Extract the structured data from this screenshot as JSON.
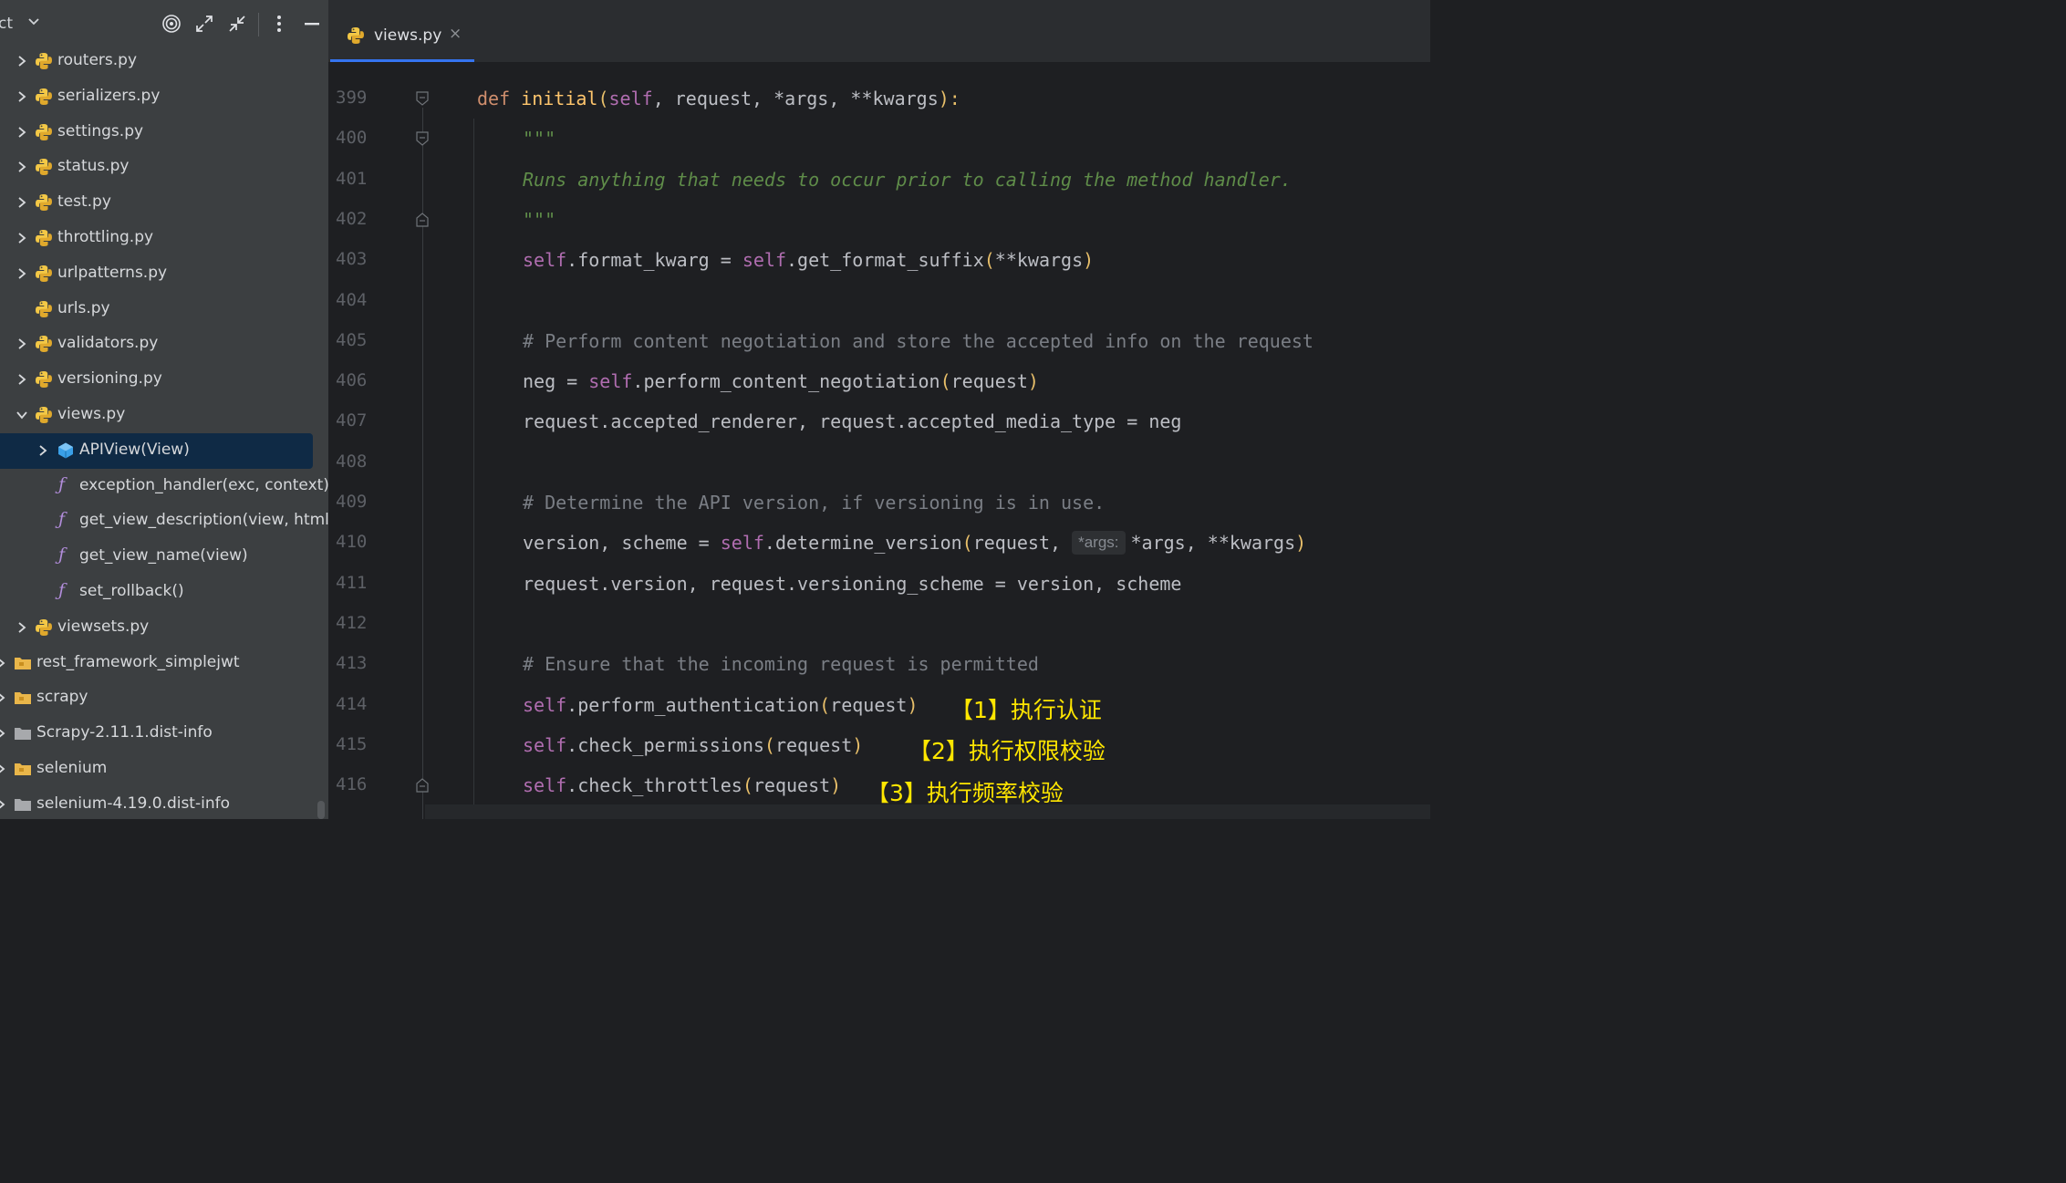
{
  "sidebar": {
    "title": "ct",
    "toolbar_icons": [
      "target-icon",
      "expand-icon",
      "collapse-icon",
      "more-vertical-icon",
      "minimize-icon"
    ],
    "items": [
      {
        "label": "routers.py",
        "type": "python-file",
        "expandable": true
      },
      {
        "label": "serializers.py",
        "type": "python-file",
        "expandable": true
      },
      {
        "label": "settings.py",
        "type": "python-file",
        "expandable": true
      },
      {
        "label": "status.py",
        "type": "python-file",
        "expandable": true
      },
      {
        "label": "test.py",
        "type": "python-file",
        "expandable": true
      },
      {
        "label": "throttling.py",
        "type": "python-file",
        "expandable": true
      },
      {
        "label": "urlpatterns.py",
        "type": "python-file",
        "expandable": true
      },
      {
        "label": "urls.py",
        "type": "python-file",
        "expandable": false
      },
      {
        "label": "validators.py",
        "type": "python-file",
        "expandable": true
      },
      {
        "label": "versioning.py",
        "type": "python-file",
        "expandable": true
      },
      {
        "label": "views.py",
        "type": "python-file",
        "expandable": true,
        "expanded": true
      },
      {
        "label": "APIView(View)",
        "type": "class",
        "expandable": true,
        "selected": true
      },
      {
        "label": "exception_handler(exc, context)",
        "type": "function"
      },
      {
        "label": "get_view_description(view, html=F",
        "type": "function"
      },
      {
        "label": "get_view_name(view)",
        "type": "function"
      },
      {
        "label": "set_rollback()",
        "type": "function"
      },
      {
        "label": "viewsets.py",
        "type": "python-file",
        "expandable": true
      },
      {
        "label": "rest_framework_simplejwt",
        "type": "package-folder"
      },
      {
        "label": "scrapy",
        "type": "package-folder"
      },
      {
        "label": "Scrapy-2.11.1.dist-info",
        "type": "folder"
      },
      {
        "label": "selenium",
        "type": "package-folder"
      },
      {
        "label": "selenium-4.19.0.dist-info",
        "type": "folder"
      }
    ]
  },
  "editor": {
    "tab": {
      "label": "views.py",
      "close": "×"
    },
    "lines": [
      {
        "num": "399",
        "fold": "start"
      },
      {
        "num": "400",
        "fold": "start"
      },
      {
        "num": "401"
      },
      {
        "num": "402",
        "fold": "end"
      },
      {
        "num": "403"
      },
      {
        "num": "404"
      },
      {
        "num": "405"
      },
      {
        "num": "406"
      },
      {
        "num": "407"
      },
      {
        "num": "408"
      },
      {
        "num": "409"
      },
      {
        "num": "410"
      },
      {
        "num": "411"
      },
      {
        "num": "412"
      },
      {
        "num": "413"
      },
      {
        "num": "414"
      },
      {
        "num": "415"
      },
      {
        "num": "416",
        "fold": "end"
      }
    ],
    "code": {
      "l399_def": "def",
      "l399_name": "initial",
      "l399_open": "(",
      "l399_self": "self",
      "l399_rest": ", request, *args, **kwargs",
      "l399_close": "):",
      "l400": "\"\"\"",
      "l401": "Runs anything that needs to occur prior to calling the method handler.",
      "l402": "\"\"\"",
      "l403_self1": "self",
      "l403_mid": ".format_kwarg = ",
      "l403_self2": "self",
      "l403_call": ".get_format_suffix",
      "l403_open": "(",
      "l403_args": "**kwargs",
      "l403_close": ")",
      "l405": "# Perform content negotiation and store the accepted info on the request",
      "l406_pre": "neg = ",
      "l406_self": "self",
      "l406_call": ".perform_content_negotiation",
      "l406_open": "(",
      "l406_args": "request",
      "l406_close": ")",
      "l407": "request.accepted_renderer, request.accepted_media_type = neg",
      "l409": "# Determine the API version, if versioning is in use.",
      "l410_pre": "version, scheme = ",
      "l410_self": "self",
      "l410_call": ".determine_version",
      "l410_open": "(",
      "l410_args1": "request, ",
      "l410_inlay": "*args:",
      "l410_args2": "*args, **kwargs",
      "l410_close": ")",
      "l411": "request.version, request.versioning_scheme = version, scheme",
      "l413": "# Ensure that the incoming request is permitted",
      "l414_self": "self",
      "l414_call": ".perform_authentication",
      "l414_open": "(",
      "l414_args": "request",
      "l414_close": ")",
      "l415_self": "self",
      "l415_call": ".check_permissions",
      "l415_open": "(",
      "l415_args": "request",
      "l415_close": ")",
      "l416_self": "self",
      "l416_call": ".check_throttles",
      "l416_open": "(",
      "l416_args": "request",
      "l416_close": ")"
    },
    "annotations": {
      "a1": "【1】执行认证",
      "a2": "【2】执行权限校验",
      "a3": "【3】执行频率校验"
    }
  },
  "colors": {
    "sidebar_bg": "#3c3f41",
    "editor_bg": "#1e1f22",
    "selection": "#0f2a45",
    "accent": "#3574f0",
    "annotation": "#ffe600"
  }
}
